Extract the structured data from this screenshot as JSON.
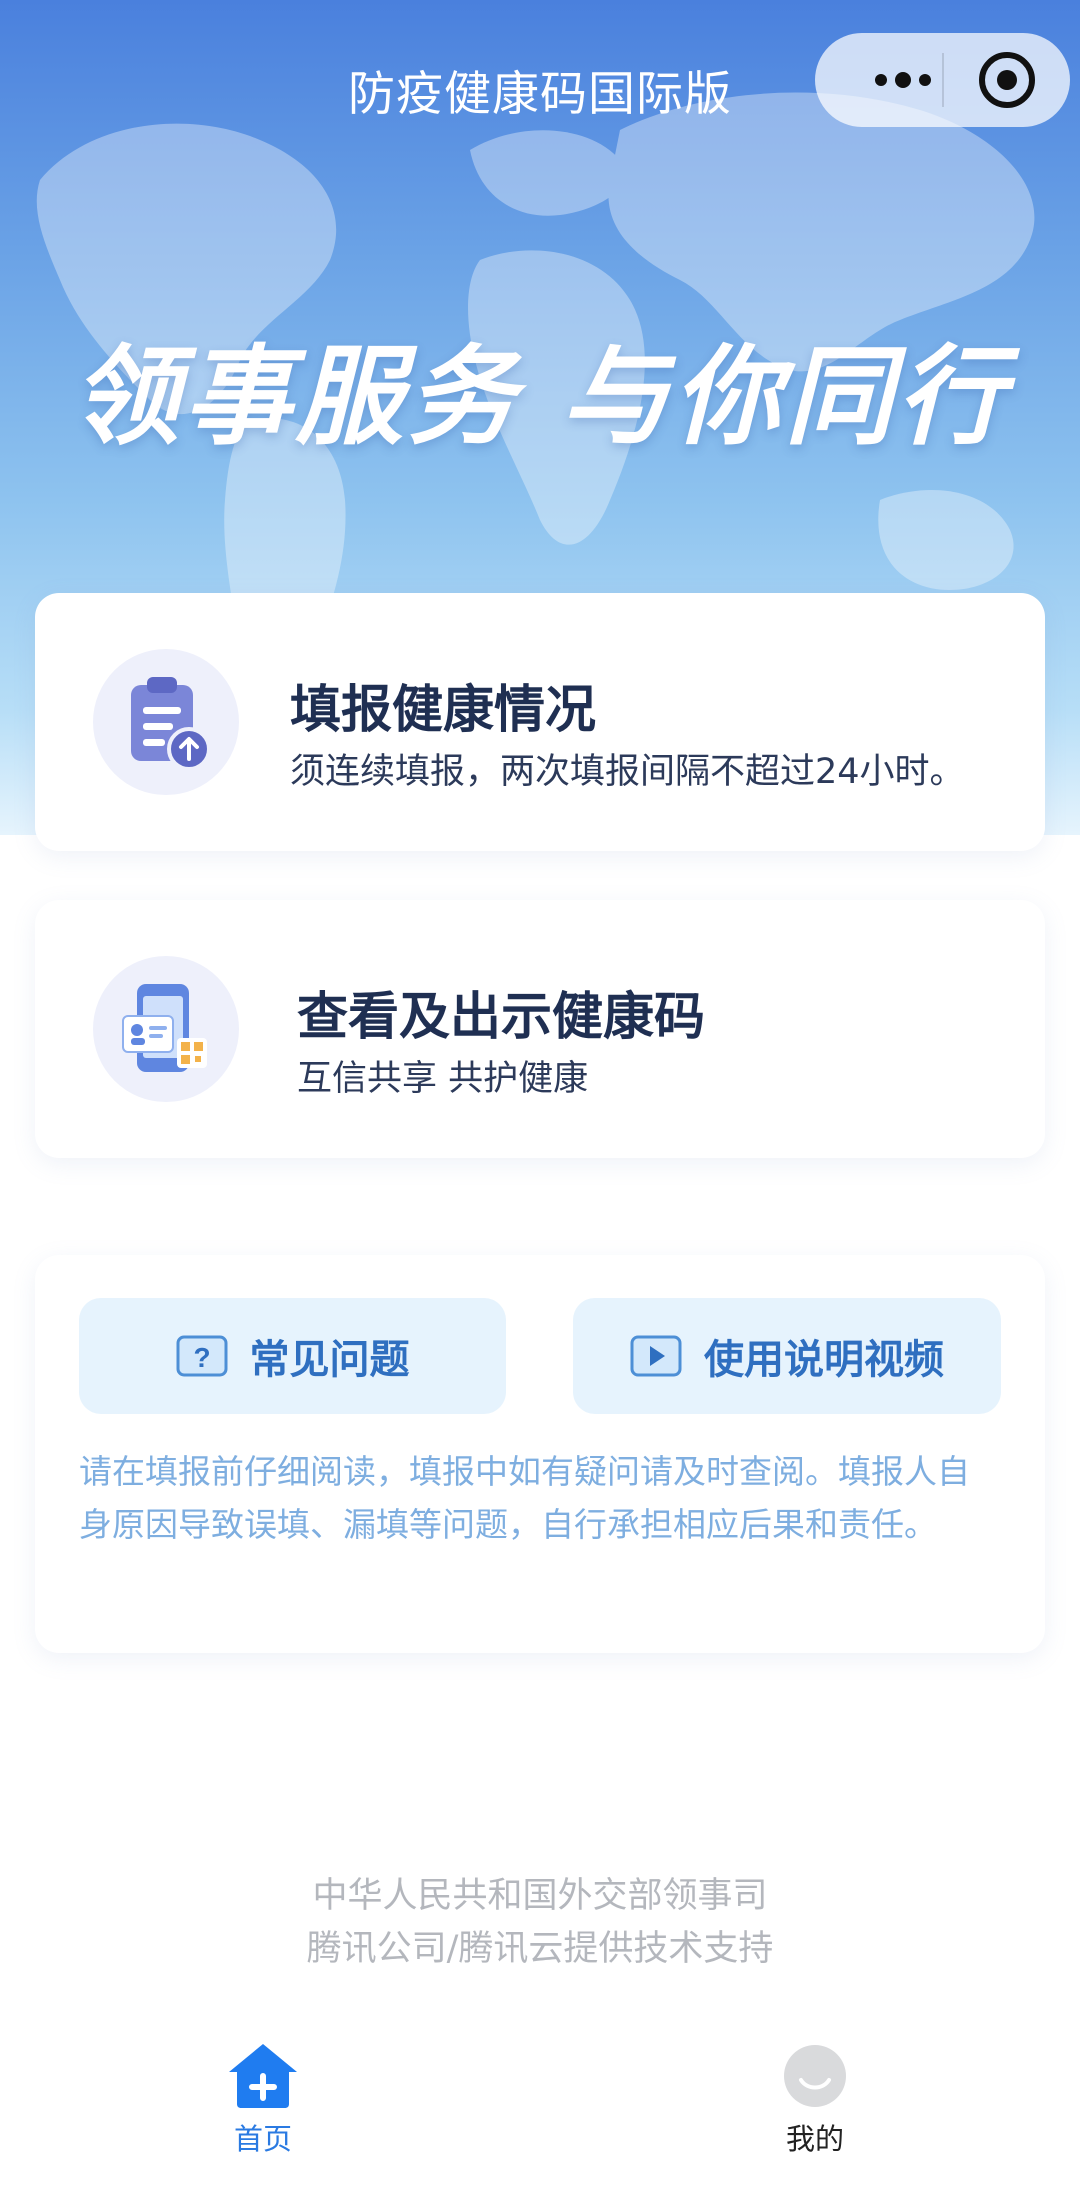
{
  "header": {
    "title": "防疫健康码国际版",
    "more_icon": "more-dots-icon",
    "close_icon": "target-circle-icon"
  },
  "hero": {
    "slogan": "领事服务 与你同行"
  },
  "cards": [
    {
      "title": "填报健康情况",
      "subtitle": "须连续填报，两次填报间隔不超过24小时。",
      "icon": "clipboard-upload-icon"
    },
    {
      "title": "查看及出示健康码",
      "subtitle": "互信共享 共护健康",
      "icon": "phone-qrcode-icon"
    }
  ],
  "help": {
    "faq_label": "常见问题",
    "faq_icon": "question-mark-icon",
    "video_label": "使用说明视频",
    "video_icon": "play-video-icon",
    "notice": "请在填报前仔细阅读，填报中如有疑问请及时查阅。填报人自身原因导致误填、漏填等问题，自行承担相应后果和责任。"
  },
  "footer": {
    "line1": "中华人民共和国外交部领事司",
    "line2": "腾讯公司/腾讯云提供技术支持"
  },
  "tabbar": {
    "home_label": "首页",
    "home_icon": "home-icon",
    "me_label": "我的",
    "me_icon": "avatar-icon"
  },
  "colors": {
    "accent": "#2a7ae2",
    "title_dark": "#1f2f52",
    "notice_text": "#7eaee0",
    "button_bg": "#e6f3fd"
  }
}
